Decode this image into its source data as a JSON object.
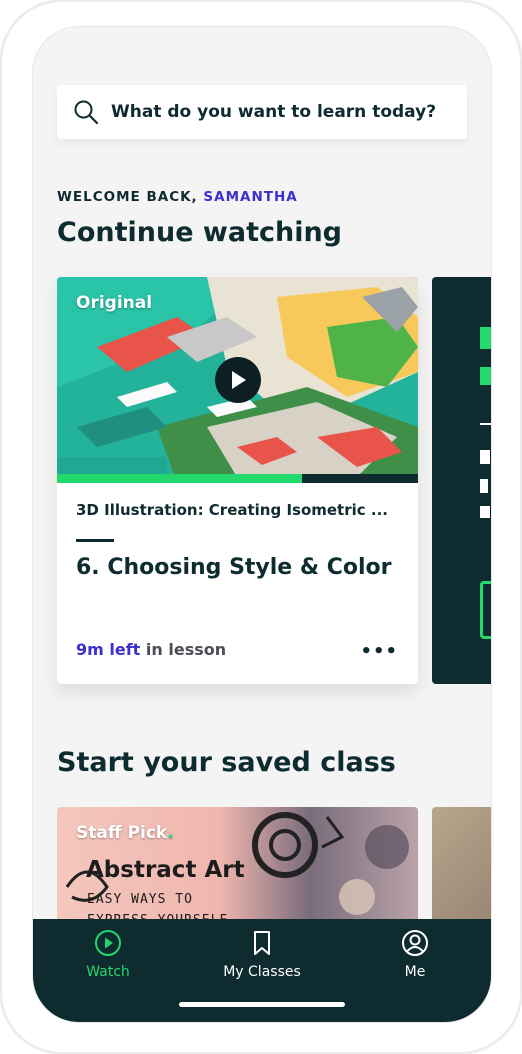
{
  "search": {
    "placeholder": "What do you want to learn today?"
  },
  "welcome": {
    "prefix": "WELCOME BACK,",
    "name": "SAMANTHA"
  },
  "continue": {
    "heading": "Continue watching",
    "card": {
      "tag": "Original",
      "course_title": "3D Illustration: Creating Isometric ...",
      "lesson_title": "6. Choosing Style & Color",
      "time_left": "9m left",
      "time_suffix": "in lesson",
      "progress": 0.68,
      "more_label": "•••"
    }
  },
  "saved": {
    "heading": "Start your saved class",
    "card": {
      "tag": "Staff Pick",
      "title": "Abstract Art",
      "subtitle_line1": "EASY WAYS TO",
      "subtitle_line2": "EXPRESS YOURSELF"
    }
  },
  "nav": {
    "items": [
      {
        "label": "Watch",
        "icon": "play-circle-icon",
        "active": true
      },
      {
        "label": "My Classes",
        "icon": "bookmark-icon",
        "active": false
      },
      {
        "label": "Me",
        "icon": "user-icon",
        "active": false
      }
    ]
  },
  "colors": {
    "brand_dark": "#0e2b30",
    "accent_green": "#23d96b",
    "accent_purple": "#3c2fd0",
    "background": "#f4f4f4"
  }
}
